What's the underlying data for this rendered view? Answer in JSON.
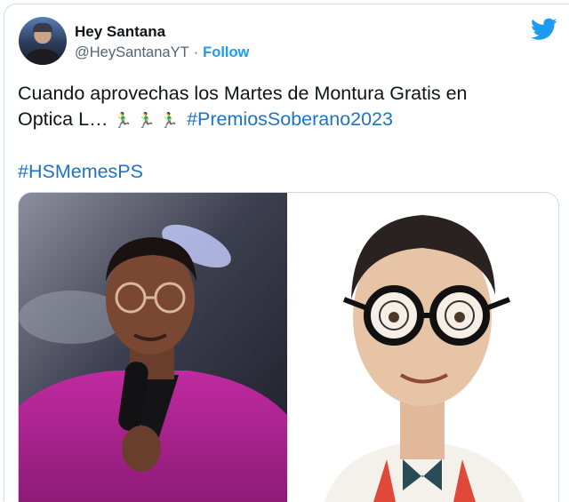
{
  "user": {
    "name": "Hey Santana",
    "handle": "@HeySantanaYT",
    "separator": "·",
    "follow_label": "Follow"
  },
  "tweet": {
    "line1": "Cuando aprovechas los Martes de Montura Gratis en",
    "line2_text": "Optica L…",
    "runners": "🏃‍♂️🏃‍♂️🏃‍♂️",
    "hashtag1": "#PremiosSoberano2023",
    "hashtag2": "#HSMemesPS"
  },
  "icons": {
    "brand": "twitter-bird-icon",
    "brand_color": "#1d9bf0",
    "hashtag_color": "#1d73c3"
  }
}
